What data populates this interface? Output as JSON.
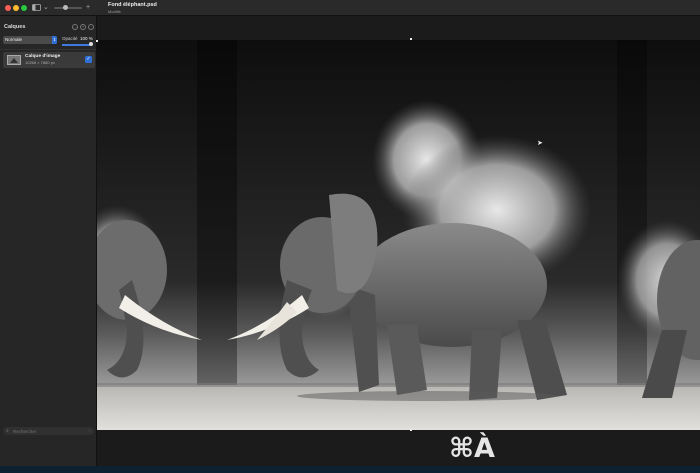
{
  "window": {
    "title": "Fond éléphant.psd",
    "subtitle": "Modifié"
  },
  "layers_panel": {
    "title": "Calques",
    "blend_mode": "Normale",
    "opacity_label": "Opacité",
    "opacity_value": "100 %",
    "opacity_fraction": 1.0,
    "layers": [
      {
        "name": "Calque d'image",
        "meta": "10268 × 7880 px",
        "visible": true
      }
    ]
  },
  "search": {
    "placeholder": "Rechercher"
  },
  "overlay": {
    "shortcut": "⌘À"
  },
  "colors": {
    "accent": "#2f6fd6",
    "sidebar_bg": "#262626",
    "canvas_bg": "#151515"
  },
  "icons": {
    "sidebar_toggle": "sidebar-icon",
    "search": "search-icon",
    "visibility": "checkbox-icon"
  }
}
